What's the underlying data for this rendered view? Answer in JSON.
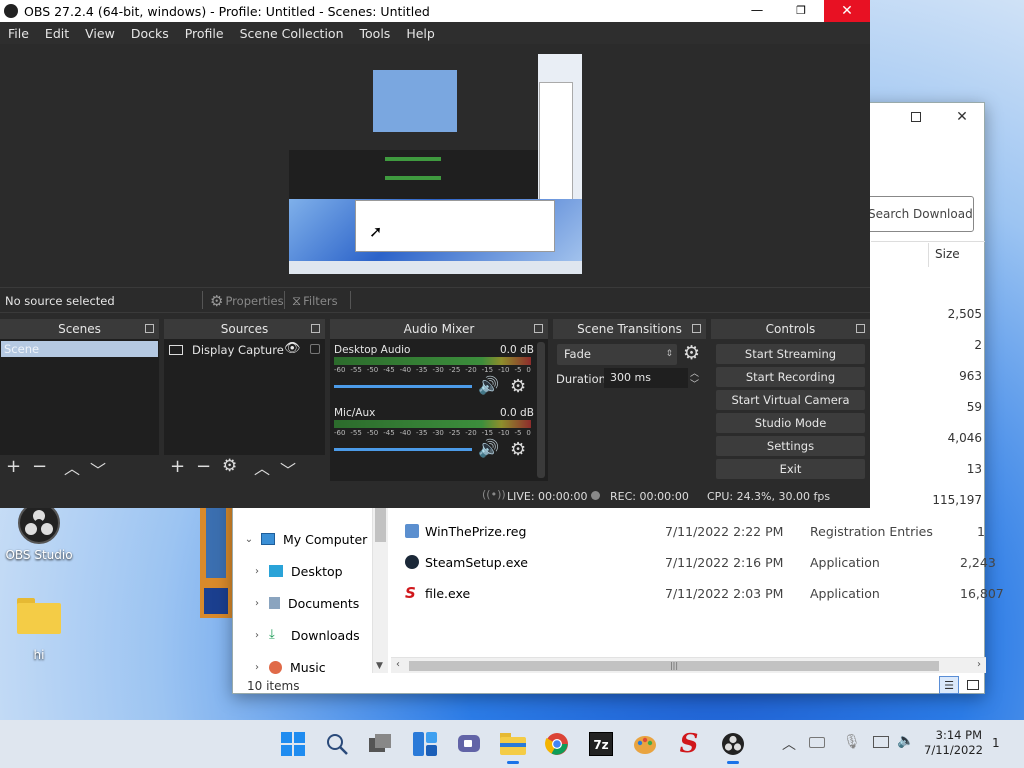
{
  "obs": {
    "title": "OBS 27.2.4 (64-bit, windows) - Profile: Untitled - Scenes: Untitled",
    "menu": [
      "File",
      "Edit",
      "View",
      "Docks",
      "Profile",
      "Scene Collection",
      "Tools",
      "Help"
    ],
    "no_source": "No source selected",
    "properties": "Properties",
    "filters": "Filters",
    "docks": {
      "scenes": "Scenes",
      "sources": "Sources",
      "mixer": "Audio Mixer",
      "transitions": "Scene Transitions",
      "controls": "Controls"
    },
    "scene_item": "Scene",
    "source_item": "Display Capture",
    "mixer": [
      {
        "name": "Desktop Audio",
        "db": "0.0 dB"
      },
      {
        "name": "Mic/Aux",
        "db": "0.0 dB"
      }
    ],
    "ticks": [
      "-60",
      "-55",
      "-50",
      "-45",
      "-40",
      "-35",
      "-30",
      "-25",
      "-20",
      "-15",
      "-10",
      "-5",
      "0"
    ],
    "transition": "Fade",
    "duration_label": "Duration",
    "duration_value": "300 ms",
    "controls": [
      "Start Streaming",
      "Start Recording",
      "Start Virtual Camera",
      "Studio Mode",
      "Settings",
      "Exit"
    ],
    "status": {
      "live": "LIVE: 00:00:00",
      "rec": "REC: 00:00:00",
      "cpu": "CPU: 24.3%, 30.00 fps"
    },
    "colors": {
      "accent": "#4c9be8",
      "scene_selected": "#b5c9e2"
    }
  },
  "explorer": {
    "search_placeholder": "Search Downloads",
    "size_header": "Size",
    "right_sizes": [
      "2,505",
      "2",
      "963",
      "59",
      "4,046",
      "13",
      "115,197"
    ],
    "tree": [
      {
        "label": "My Computer",
        "expanded": true
      },
      {
        "label": "Desktop"
      },
      {
        "label": "Documents"
      },
      {
        "label": "Downloads"
      },
      {
        "label": "Music"
      }
    ],
    "files": [
      {
        "name": "WinThePrize.reg",
        "date": "7/11/2022 2:22 PM",
        "type": "Registration Entries",
        "size": "1"
      },
      {
        "name": "SteamSetup.exe",
        "date": "7/11/2022 2:16 PM",
        "type": "Application",
        "size": "2,243"
      },
      {
        "name": "file.exe",
        "date": "7/11/2022 2:03 PM",
        "type": "Application",
        "size": "16,807"
      }
    ],
    "count": "10 items"
  },
  "desktop": {
    "icons": [
      {
        "label": "OBS Studio",
        "icon": "obs-icon"
      },
      {
        "label": "hi",
        "icon": "folder-icon"
      }
    ]
  },
  "taskbar": {
    "time": "3:14 PM",
    "date": "7/11/2022",
    "notification_count": "1"
  }
}
